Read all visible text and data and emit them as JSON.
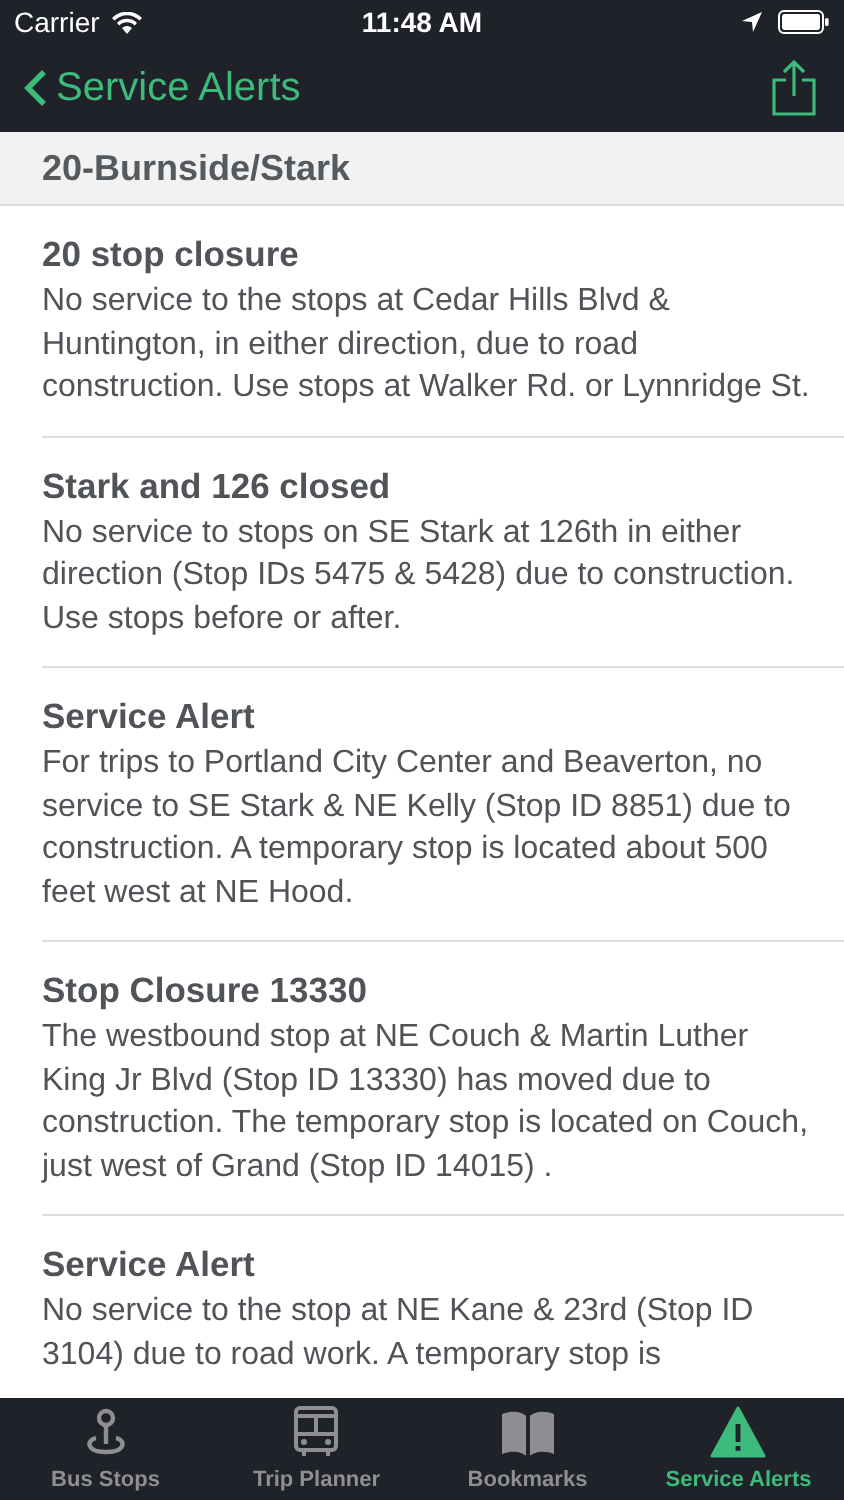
{
  "status_bar": {
    "carrier": "Carrier",
    "time": "11:48 AM"
  },
  "nav": {
    "back_label": "Service Alerts"
  },
  "section": {
    "title": "20-Burnside/Stark"
  },
  "alerts": [
    {
      "title": "20 stop closure",
      "body": "No service to the stops at Cedar Hills Blvd & Huntington, in either direction, due to road construction. Use stops at Walker Rd. or Lynnridge St."
    },
    {
      "title": "Stark and 126 closed",
      "body": "No service to stops on SE Stark at 126th in either direction (Stop IDs 5475 & 5428) due to construction. Use stops before or after."
    },
    {
      "title": "Service Alert",
      "body": "For trips to Portland City Center and Beaverton, no service to SE Stark & NE Kelly (Stop ID 8851) due to construction. A temporary stop is located about 500 feet west at NE Hood."
    },
    {
      "title": "Stop Closure 13330",
      "body": "The westbound stop at NE Couch & Martin Luther King Jr Blvd (Stop ID 13330) has moved due to construction.  The temporary stop is located on Couch, just west of Grand (Stop ID 14015) ."
    },
    {
      "title": "Service Alert",
      "body": "No service to the stop at NE Kane & 23rd (Stop ID 3104) due to road work. A temporary stop is"
    }
  ],
  "tabs": [
    {
      "kind": "pin",
      "label": "Bus Stops",
      "selected": false
    },
    {
      "kind": "bus",
      "label": "Trip Planner",
      "selected": false
    },
    {
      "kind": "book",
      "label": "Bookmarks",
      "selected": false
    },
    {
      "kind": "alert",
      "label": "Service Alerts",
      "selected": true
    }
  ]
}
